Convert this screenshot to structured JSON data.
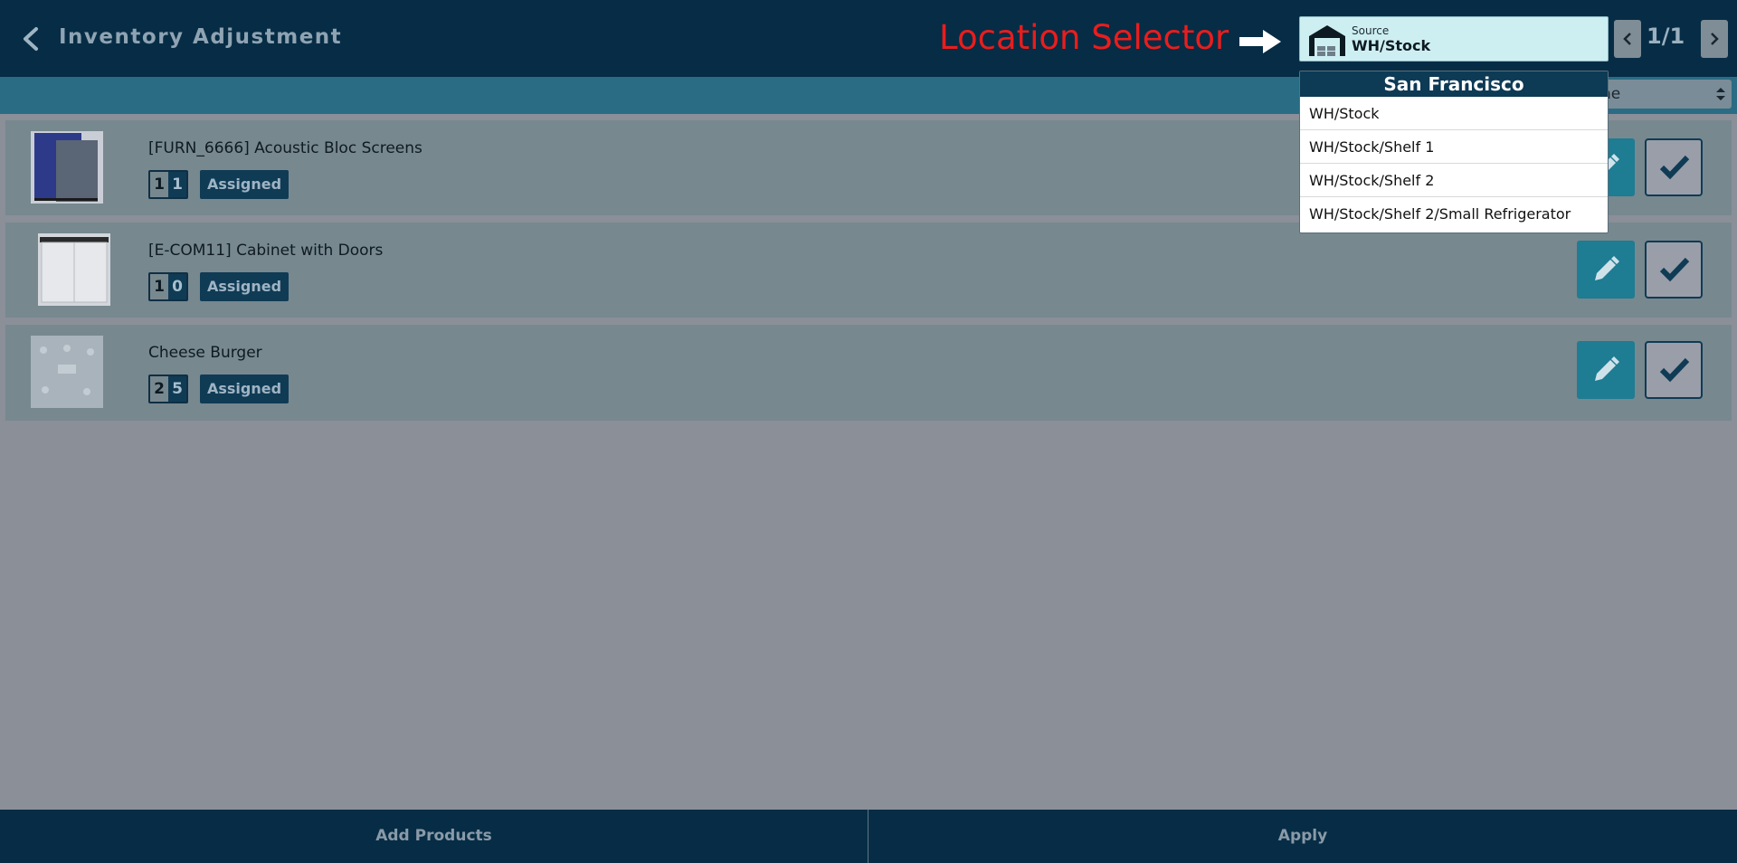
{
  "header": {
    "title": "Inventory Adjustment",
    "annotation": "Location Selector",
    "source": {
      "caption": "Source",
      "value": "WH/Stock"
    },
    "pager": "1/1"
  },
  "sort": {
    "value": "ne"
  },
  "dropdown": {
    "group": "San Francisco",
    "items": [
      "WH/Stock",
      "WH/Stock/Shelf 1",
      "WH/Stock/Shelf 2",
      "WH/Stock/Shelf 2/Small Refrigerator"
    ]
  },
  "products": [
    {
      "name": "[FURN_6666] Acoustic Bloc Screens",
      "qty_a": "1",
      "qty_b": "1",
      "status": "Assigned"
    },
    {
      "name": "[E-COM11] Cabinet with Doors",
      "qty_a": "1",
      "qty_b": "0",
      "status": "Assigned"
    },
    {
      "name": "Cheese Burger",
      "qty_a": "2",
      "qty_b": "5",
      "status": "Assigned"
    }
  ],
  "footer": {
    "add_label": "Add Products",
    "apply_label": "Apply"
  },
  "colors": {
    "header_bg": "#062d45",
    "annotation_red": "#ea1d1d",
    "accent_teal": "#1e7c93"
  }
}
